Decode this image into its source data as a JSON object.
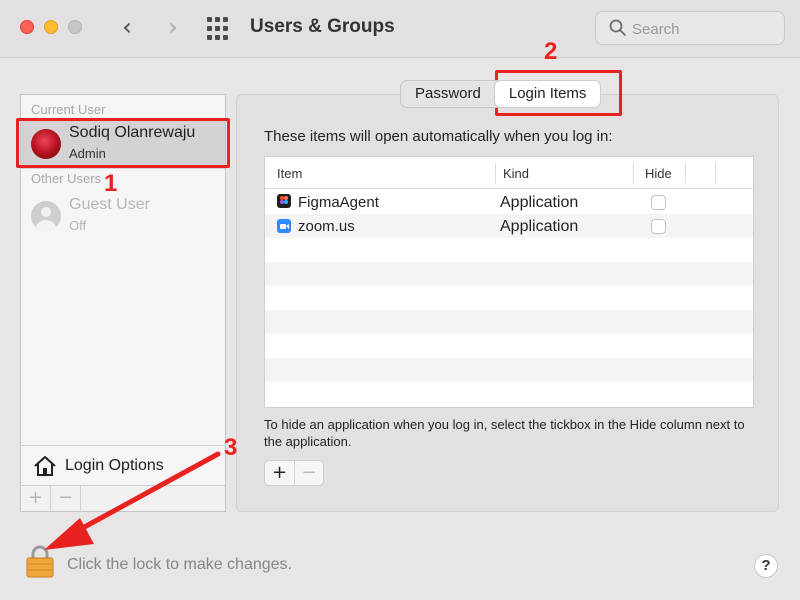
{
  "window": {
    "title": "Users & Groups"
  },
  "toolbar": {
    "back_glyph": "‹",
    "forward_glyph": "›",
    "search_placeholder": "Search"
  },
  "sidebar": {
    "current_user_label": "Current User",
    "other_users_label": "Other Users",
    "current_user": {
      "name": "Sodiq Olanrewaju",
      "role": "Admin"
    },
    "guest_user": {
      "name": "Guest User",
      "status": "Off"
    },
    "login_options_label": "Login Options",
    "add_glyph": "+",
    "remove_glyph": "−"
  },
  "tabs": [
    {
      "label": "Password",
      "active": false
    },
    {
      "label": "Login Items",
      "active": true
    }
  ],
  "login_items": {
    "intro": "These items will open automatically when you log in:",
    "columns": [
      "Item",
      "Kind",
      "Hide"
    ],
    "rows": [
      {
        "item": "FigmaAgent",
        "kind": "Application",
        "hide": false,
        "icon": "figma-app-icon"
      },
      {
        "item": "zoom.us",
        "kind": "Application",
        "hide": false,
        "icon": "zoom-app-icon"
      }
    ],
    "help_text": "To hide an application when you log in, select the tickbox in the Hide column next to the application.",
    "add_glyph": "+",
    "remove_glyph": "−"
  },
  "footer": {
    "lock_text": "Click the lock to make changes.",
    "help_glyph": "?"
  },
  "annotations": {
    "step_1": "1",
    "step_2": "2",
    "step_3": "3",
    "color": "#e8231f"
  },
  "colors": {
    "close": "#fe5f57",
    "minimize": "#febc2e",
    "lock": "#f0a63a"
  }
}
